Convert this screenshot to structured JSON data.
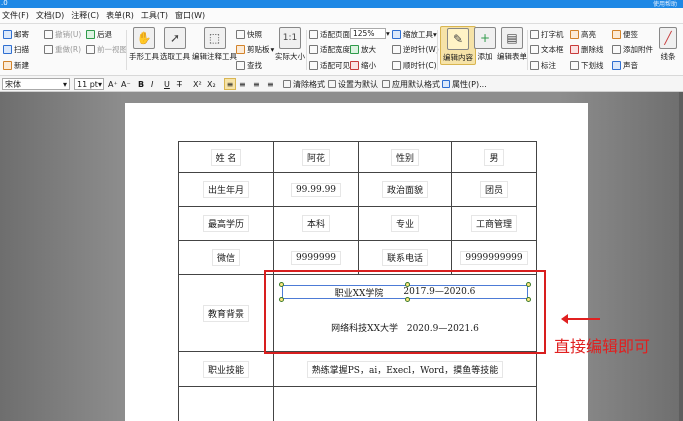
{
  "window": {
    "version": ".0",
    "help": "使用帮助"
  },
  "menu": [
    "文件(F)",
    "文档(D)",
    "注释(C)",
    "表单(R)",
    "工具(T)",
    "窗口(W)"
  ],
  "ribbon": {
    "mail": "邮寄",
    "undo": "撤销(U)",
    "back": "后退",
    "scan": "扫描",
    "redo": "重做(R)",
    "forward": "前一视图",
    "new": "新建",
    "hand_tool": "手形工具",
    "select_tool": "选取工具",
    "edit_annot_tool": "编辑注释工具",
    "snapshot": "快照",
    "clipboard": "剪贴板",
    "find": "查找",
    "actual_size": "实际大小",
    "fit_page": "适配页面",
    "fit_width": "适配宽度",
    "fit_visible": "适配可见",
    "zoom_value": "125%",
    "zoom_in": "放大",
    "zoom_out": "缩小",
    "zoom_tool": "缩放工具",
    "rotate_left": "逆时针(W)",
    "rotate_right": "顺时针(C)",
    "edit_content": "编辑内容",
    "add": "添加",
    "edit_form": "编辑表单",
    "typewriter": "打字机",
    "textbox": "文本框",
    "callout": "标注",
    "highlight": "高亮",
    "strikeout": "删除线",
    "underline": "下划线",
    "sticky": "便签",
    "attach": "添加附件",
    "sound": "声音",
    "line": "线条"
  },
  "format": {
    "font": "宋体",
    "size": "11 pt",
    "clear": "清除格式",
    "set_default": "设置为默认",
    "apply_default": "应用默认格式",
    "properties": "属性(P)..."
  },
  "resume": {
    "name_label": "姓 名",
    "name": "阿花",
    "gender_label": "性别",
    "gender": "男",
    "birth_label": "出生年月",
    "birth": "99.99.99",
    "politics_label": "政治面貌",
    "politics": "团员",
    "degree_label": "最高学历",
    "degree": "本科",
    "major_label": "专业",
    "major": "工商管理",
    "wechat_label": "微信",
    "wechat": "9999999",
    "phone_label": "联系电话",
    "phone": "9999999999",
    "edu_label": "教育背景",
    "edu1_school": "职业XX学院",
    "edu1_period": "2017.9—2020.6",
    "edu2_school": "网络科技XX大学",
    "edu2_period": "2020.9—2021.6",
    "skills_label": "职业技能",
    "skills": "熟练掌握PS，ai，Execl，Word，摸鱼等技能"
  },
  "annotation": {
    "text": "直接编辑即可"
  }
}
